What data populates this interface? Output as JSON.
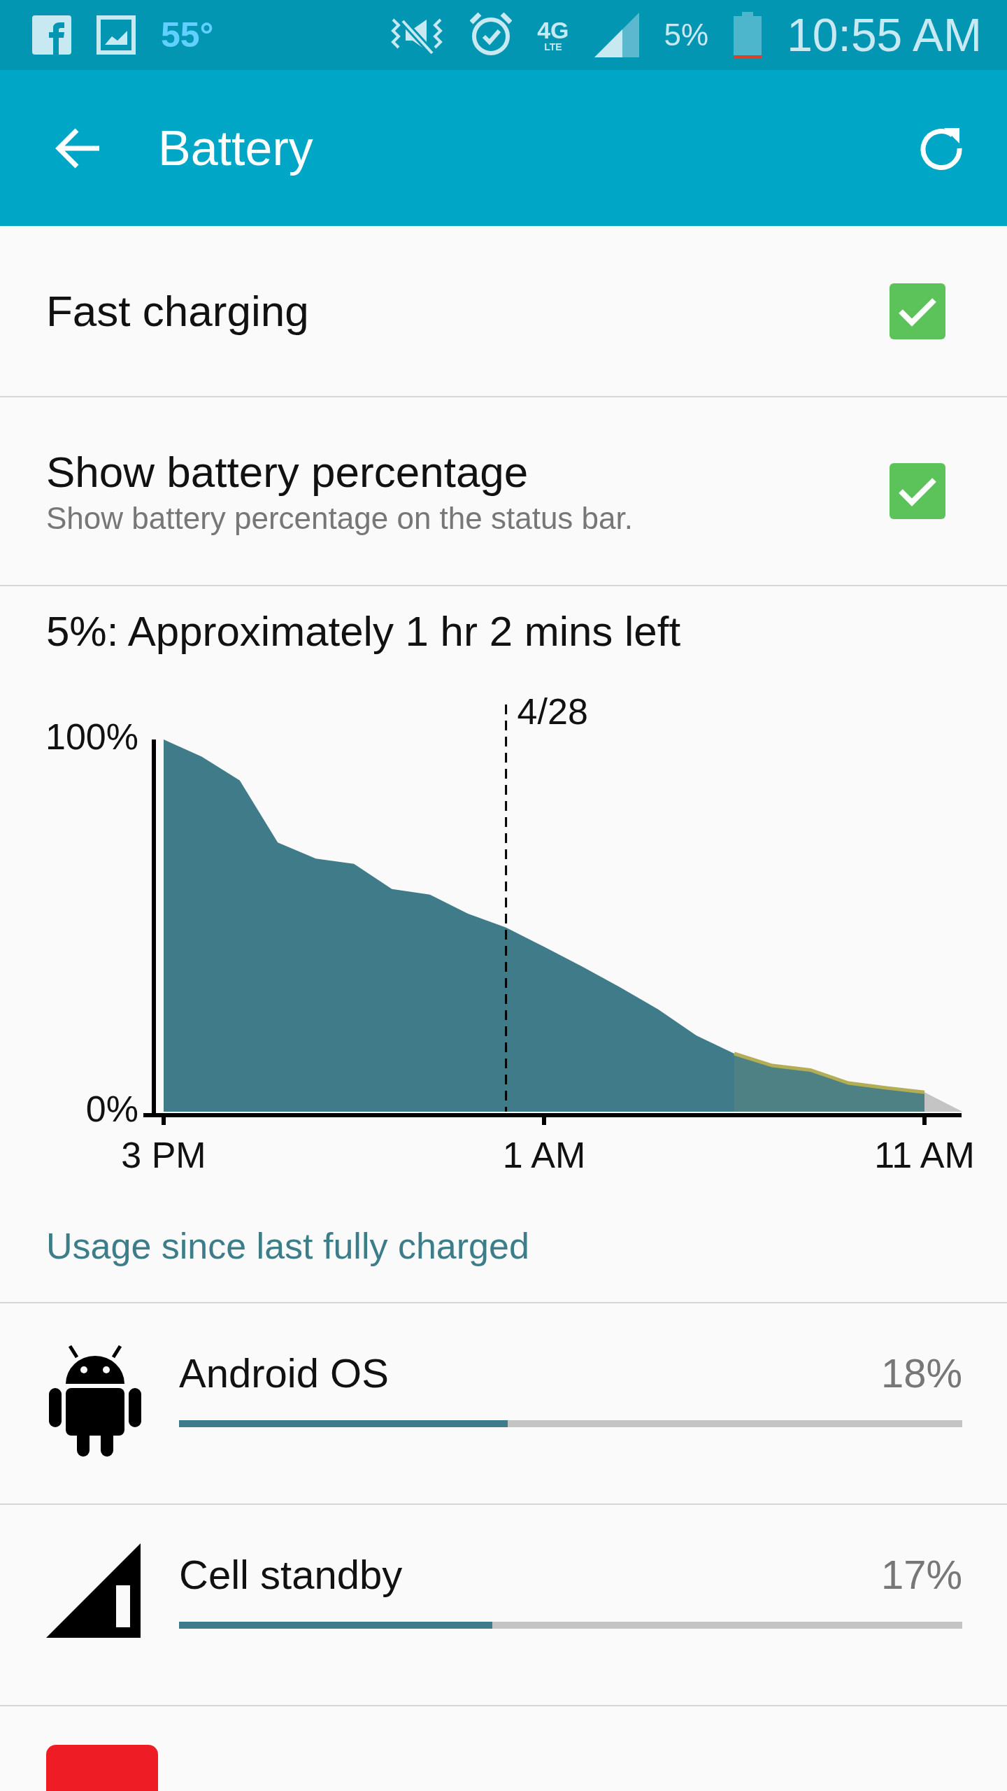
{
  "status_bar": {
    "temperature": "55°",
    "network": "4G",
    "network_sub": "LTE",
    "battery_text": "5%",
    "time": "10:55 AM"
  },
  "app_bar": {
    "title": "Battery"
  },
  "settings": [
    {
      "label": "Fast charging",
      "checked": true
    },
    {
      "label": "Show battery percentage",
      "summary": "Show battery percentage on the status bar.",
      "checked": true
    }
  ],
  "estimate": "5%: Approximately 1 hr 2 mins left",
  "chart_data": {
    "type": "area",
    "categories": [
      "3 PM",
      null,
      null,
      null,
      null,
      null,
      null,
      null,
      null,
      null,
      "1 AM",
      null,
      null,
      null,
      null,
      null,
      null,
      null,
      null,
      null,
      "11 AM",
      null
    ],
    "series": [
      {
        "color": "#407b8a",
        "values": [
          100,
          95.4,
          89,
          72.3,
          68,
          66.6,
          59.8,
          58.3,
          53.2,
          49.5,
          44.3,
          39,
          33.4,
          27.5,
          20.5,
          15.6,
          12.4,
          11.2,
          7.7,
          6.4,
          5.2,
          null
        ]
      },
      {
        "color": "#b3ad55",
        "values": [
          null,
          null,
          null,
          null,
          null,
          null,
          null,
          null,
          null,
          null,
          null,
          null,
          null,
          null,
          null,
          15.6,
          12.4,
          11.2,
          7.7,
          6.4,
          5.2,
          null
        ]
      },
      {
        "color": "#c4c4c4",
        "values": [
          null,
          null,
          null,
          null,
          null,
          null,
          null,
          null,
          null,
          null,
          null,
          null,
          null,
          null,
          null,
          null,
          null,
          null,
          null,
          null,
          5.2,
          0
        ]
      }
    ],
    "ylim": [
      0,
      100
    ],
    "yticks": [
      {
        "value": 0,
        "label": "0%"
      },
      {
        "value": 100,
        "label": "100%"
      }
    ],
    "annotations": [
      "4/28"
    ]
  },
  "usage_link": "Usage since last fully charged",
  "usage": [
    {
      "kind": "android",
      "name": "Android OS",
      "percent": "18%",
      "level": 0.42
    },
    {
      "kind": "signal",
      "name": "Cell standby",
      "percent": "17%",
      "level": 0.4
    },
    {
      "kind": "red"
    }
  ]
}
